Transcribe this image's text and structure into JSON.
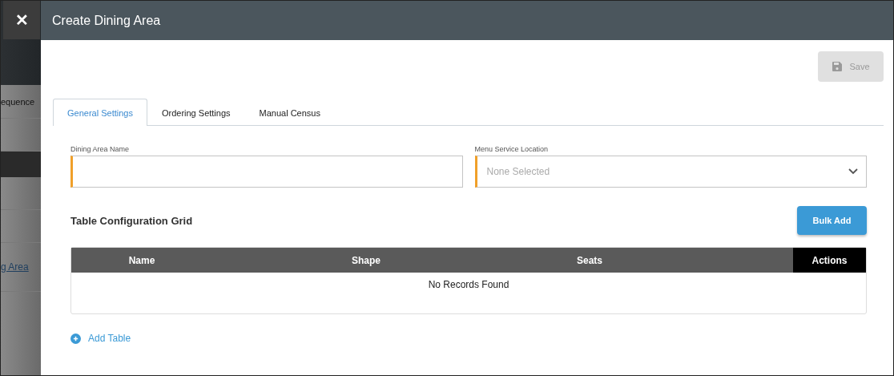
{
  "background": {
    "items": [
      {
        "text": "equence",
        "kind": "text"
      },
      {
        "text": "g Area",
        "kind": "link"
      }
    ]
  },
  "dialog": {
    "title": "Create Dining Area",
    "close_icon": "✕"
  },
  "save_button": {
    "label": "Save",
    "disabled": true
  },
  "tabs": [
    {
      "label": "General Settings",
      "selected": true
    },
    {
      "label": "Ordering Settings",
      "selected": false
    },
    {
      "label": "Manual Census",
      "selected": false
    }
  ],
  "fields": [
    {
      "label": "Dining Area Name",
      "kind": "text",
      "required": true
    },
    {
      "label": "Menu Service Location",
      "kind": "select",
      "placeholder": "None Selected",
      "required": true
    }
  ],
  "grid": {
    "title": "Table Configuration Grid",
    "bulk_add": "Bulk Add",
    "columns": [
      "Name",
      "Shape",
      "Seats",
      "Actions"
    ],
    "empty_message": "No Records Found"
  },
  "add_table": "Add Table"
}
